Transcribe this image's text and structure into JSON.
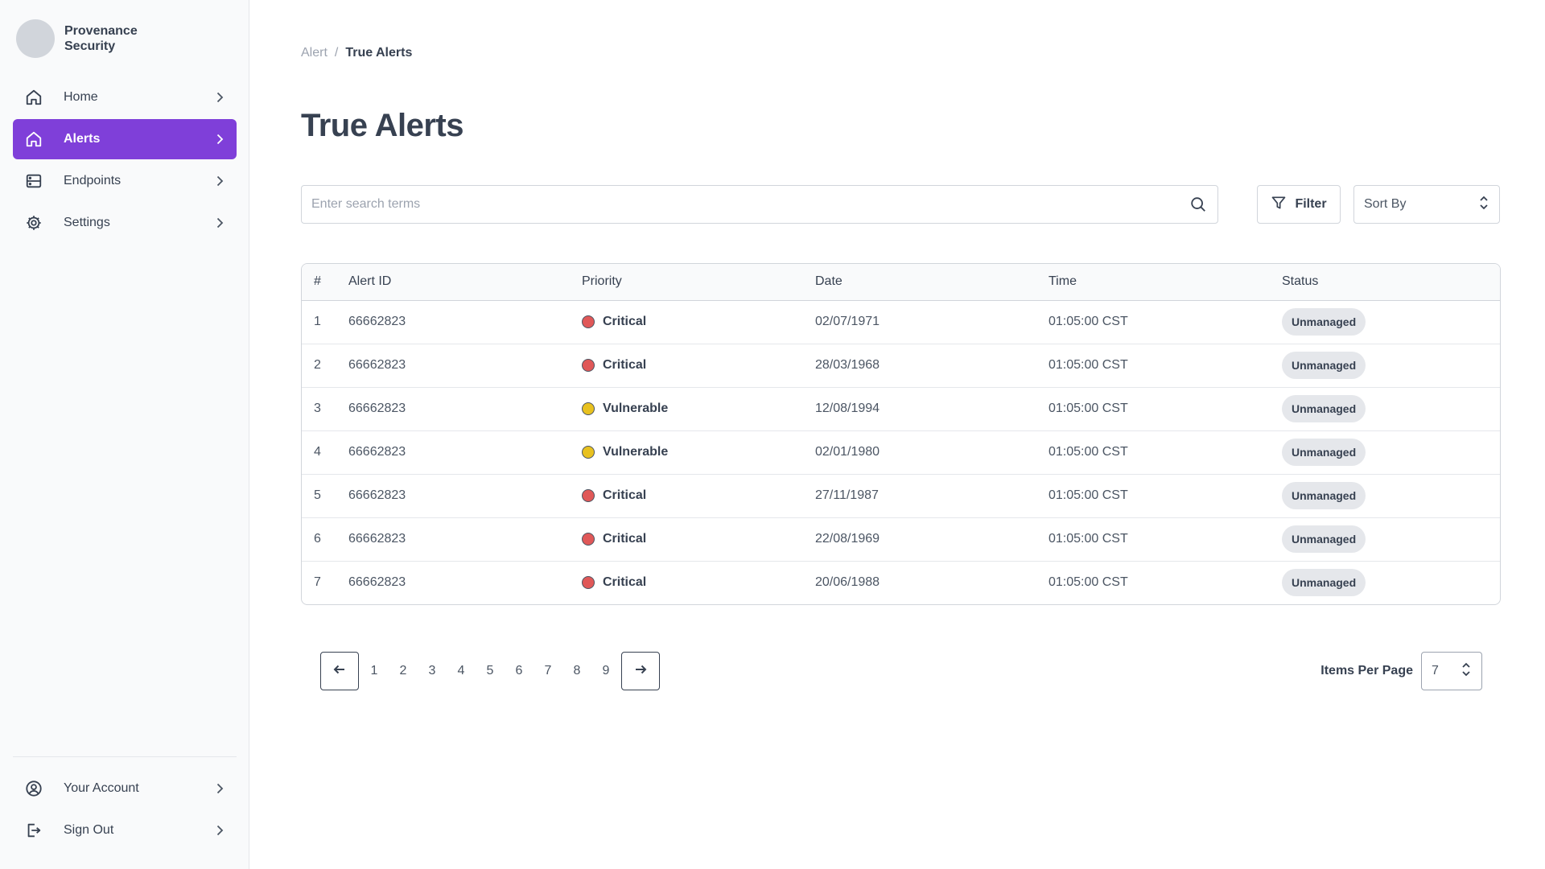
{
  "brand": {
    "name": "Provenance Security"
  },
  "sidebar": {
    "items": [
      {
        "label": "Home",
        "icon": "home-icon"
      },
      {
        "label": "Alerts",
        "icon": "home-icon",
        "active": true
      },
      {
        "label": "Endpoints",
        "icon": "server-icon"
      },
      {
        "label": "Settings",
        "icon": "gear-icon"
      }
    ],
    "bottom_items": [
      {
        "label": "Your Account",
        "icon": "user-circle-icon"
      },
      {
        "label": "Sign Out",
        "icon": "sign-out-icon"
      }
    ]
  },
  "colors": {
    "accent": "#7f3fd9",
    "critical": "#e05858",
    "vulnerable": "#e8c11f"
  },
  "breadcrumb": {
    "parent": "Alert",
    "separator": "/",
    "current": "True Alerts"
  },
  "page": {
    "title": "True Alerts"
  },
  "search": {
    "placeholder": "Enter search terms",
    "value": ""
  },
  "toolbar": {
    "filter_label": "Filter",
    "sort_label": "Sort By"
  },
  "table": {
    "columns": [
      "#",
      "Alert ID",
      "Priority",
      "Date",
      "Time",
      "Status"
    ],
    "rows": [
      {
        "num": "1",
        "id": "66662823",
        "priority": "Critical",
        "date": "02/07/1971",
        "time": "01:05:00 CST",
        "status": "Unmanaged"
      },
      {
        "num": "2",
        "id": "66662823",
        "priority": "Critical",
        "date": "28/03/1968",
        "time": "01:05:00 CST",
        "status": "Unmanaged"
      },
      {
        "num": "3",
        "id": "66662823",
        "priority": "Vulnerable",
        "date": "12/08/1994",
        "time": "01:05:00 CST",
        "status": "Unmanaged"
      },
      {
        "num": "4",
        "id": "66662823",
        "priority": "Vulnerable",
        "date": "02/01/1980",
        "time": "01:05:00 CST",
        "status": "Unmanaged"
      },
      {
        "num": "5",
        "id": "66662823",
        "priority": "Critical",
        "date": "27/11/1987",
        "time": "01:05:00 CST",
        "status": "Unmanaged"
      },
      {
        "num": "6",
        "id": "66662823",
        "priority": "Critical",
        "date": "22/08/1969",
        "time": "01:05:00 CST",
        "status": "Unmanaged"
      },
      {
        "num": "7",
        "id": "66662823",
        "priority": "Critical",
        "date": "20/06/1988",
        "time": "01:05:00 CST",
        "status": "Unmanaged"
      }
    ]
  },
  "pagination": {
    "pages": [
      "1",
      "2",
      "3",
      "4",
      "5",
      "6",
      "7",
      "8",
      "9"
    ],
    "items_per_page_label": "Items Per Page",
    "items_per_page_value": "7"
  }
}
